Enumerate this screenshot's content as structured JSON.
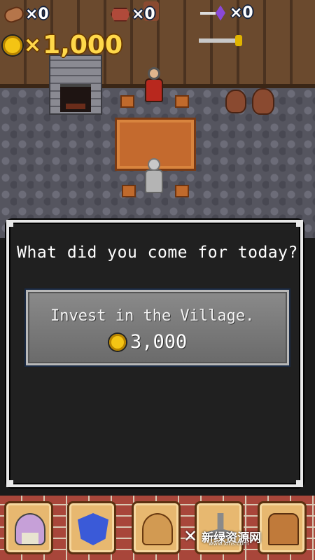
{
  "hud": {
    "wood": {
      "icon": "wood-log-icon",
      "count": "×0"
    },
    "ore": {
      "icon": "ore-icon",
      "count": "×0"
    },
    "gem": {
      "icon": "sword-gem-icon",
      "count": "×0"
    },
    "gold": {
      "icon": "gold-coin-icon",
      "times": "×",
      "amount": "1,000"
    }
  },
  "dialog": {
    "question": "What did you come for today?",
    "option": {
      "label": "Invest in the Village.",
      "cost": "3,000",
      "cost_icon": "gold-coin-icon"
    }
  },
  "menu": [
    {
      "name": "village",
      "icon": "village-icon"
    },
    {
      "name": "equipment",
      "icon": "sword-shield-icon"
    },
    {
      "name": "shop",
      "icon": "shop-hut-icon"
    },
    {
      "name": "craft",
      "icon": "hammer-sparkle-icon"
    },
    {
      "name": "storage",
      "icon": "treasure-chest-icon"
    }
  ],
  "watermark": {
    "text": "新绿资源网",
    "url": "www.xlhs.com"
  },
  "colors": {
    "gold": "#ffd84a",
    "dialog_bg": "#202020",
    "button": "#7a7a7a",
    "brick": "#a8463a"
  }
}
